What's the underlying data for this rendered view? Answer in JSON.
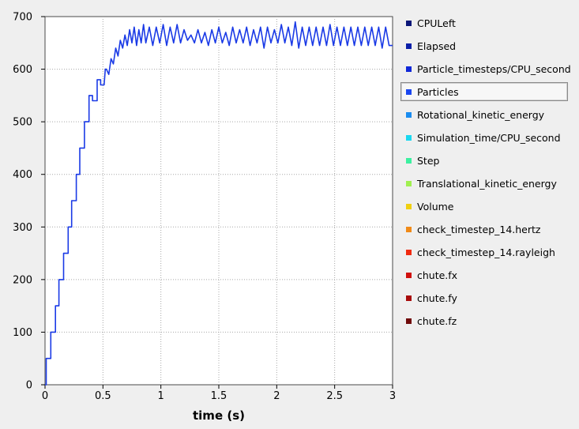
{
  "chart_data": {
    "type": "line",
    "xlabel": "time (s)",
    "ylabel": "",
    "xlim": [
      0,
      3
    ],
    "ylim": [
      0,
      700
    ],
    "xticks": [
      0,
      0.5,
      1,
      1.5,
      2,
      2.5,
      3
    ],
    "xtick_labels": [
      "0",
      "0.5",
      "1",
      "1.5",
      "2",
      "2.5",
      "3"
    ],
    "yticks": [
      0,
      100,
      200,
      300,
      400,
      500,
      600,
      700
    ],
    "ytick_labels": [
      "0",
      "100",
      "200",
      "300",
      "400",
      "500",
      "600",
      "700"
    ],
    "grid": true,
    "legend_position": "right",
    "selected_series": "Particles",
    "series": [
      {
        "name": "Particles",
        "color": "#1a3ae6",
        "x": [
          0,
          0.01,
          0.01,
          0.05,
          0.05,
          0.09,
          0.09,
          0.12,
          0.12,
          0.16,
          0.16,
          0.2,
          0.2,
          0.23,
          0.23,
          0.27,
          0.27,
          0.3,
          0.3,
          0.34,
          0.34,
          0.38,
          0.38,
          0.41,
          0.41,
          0.45,
          0.45,
          0.48,
          0.48,
          0.51,
          0.52,
          0.53,
          0.55,
          0.57,
          0.59,
          0.61,
          0.63,
          0.65,
          0.67,
          0.69,
          0.71,
          0.73,
          0.75,
          0.77,
          0.79,
          0.81,
          0.83,
          0.85,
          0.87,
          0.9,
          0.93,
          0.96,
          0.99,
          1.02,
          1.05,
          1.08,
          1.11,
          1.14,
          1.17,
          1.2,
          1.23,
          1.26,
          1.29,
          1.32,
          1.35,
          1.38,
          1.41,
          1.44,
          1.47,
          1.5,
          1.53,
          1.56,
          1.59,
          1.62,
          1.65,
          1.68,
          1.71,
          1.74,
          1.77,
          1.8,
          1.83,
          1.86,
          1.89,
          1.92,
          1.95,
          1.98,
          2.01,
          2.04,
          2.07,
          2.1,
          2.13,
          2.16,
          2.19,
          2.22,
          2.25,
          2.28,
          2.31,
          2.34,
          2.37,
          2.4,
          2.43,
          2.46,
          2.49,
          2.52,
          2.55,
          2.58,
          2.61,
          2.64,
          2.67,
          2.7,
          2.73,
          2.76,
          2.79,
          2.82,
          2.85,
          2.88,
          2.91,
          2.94,
          2.97,
          3.0
        ],
        "y": [
          0,
          0,
          50,
          50,
          100,
          100,
          150,
          150,
          200,
          200,
          250,
          250,
          300,
          300,
          350,
          350,
          400,
          400,
          450,
          450,
          500,
          500,
          550,
          550,
          540,
          540,
          580,
          580,
          570,
          570,
          600,
          600,
          590,
          620,
          610,
          640,
          625,
          655,
          640,
          665,
          645,
          675,
          650,
          680,
          645,
          675,
          650,
          685,
          650,
          680,
          645,
          680,
          650,
          685,
          645,
          680,
          650,
          685,
          650,
          675,
          655,
          665,
          650,
          675,
          650,
          670,
          645,
          675,
          650,
          680,
          650,
          670,
          645,
          680,
          650,
          675,
          650,
          680,
          645,
          675,
          650,
          680,
          640,
          680,
          650,
          675,
          650,
          685,
          650,
          680,
          645,
          690,
          640,
          680,
          645,
          680,
          645,
          680,
          645,
          680,
          645,
          685,
          645,
          680,
          645,
          680,
          645,
          680,
          645,
          680,
          645,
          680,
          645,
          680,
          645,
          680,
          640,
          680,
          645,
          645
        ]
      }
    ]
  },
  "legend": {
    "items": [
      {
        "label": "CPULeft",
        "color": "#0a1678"
      },
      {
        "label": "Elapsed",
        "color": "#0b1fa8"
      },
      {
        "label": "Particle_timesteps/CPU_second",
        "color": "#1028d8"
      },
      {
        "label": "Particles",
        "color": "#1a46f0"
      },
      {
        "label": "Rotational_kinetic_energy",
        "color": "#1a8cf0"
      },
      {
        "label": "Simulation_time/CPU_second",
        "color": "#1ad8f0"
      },
      {
        "label": "Step",
        "color": "#3cf0a0"
      },
      {
        "label": "Translational_kinetic_energy",
        "color": "#a0f050"
      },
      {
        "label": "Volume",
        "color": "#f0d010"
      },
      {
        "label": "check_timestep_14.hertz",
        "color": "#f08a18"
      },
      {
        "label": "check_timestep_14.rayleigh",
        "color": "#f02a10"
      },
      {
        "label": "chute.fx",
        "color": "#d0100e"
      },
      {
        "label": "chute.fy",
        "color": "#a80c0c"
      },
      {
        "label": "chute.fz",
        "color": "#700a0a"
      }
    ]
  }
}
